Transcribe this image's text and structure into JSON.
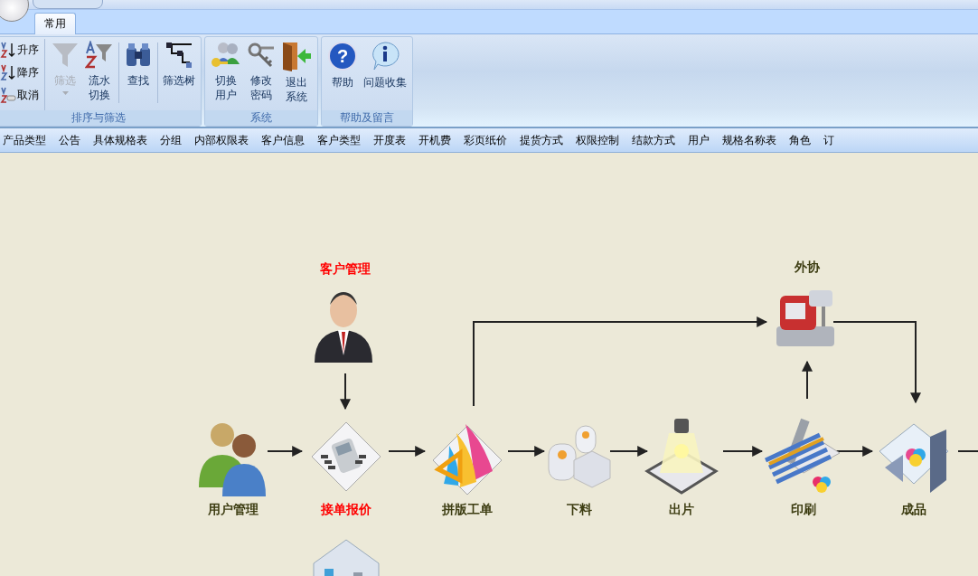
{
  "ribbon": {
    "tabs": [
      {
        "label": "常用",
        "selected": true
      }
    ],
    "groups": [
      {
        "label": "排序与筛选",
        "small_buttons": [
          {
            "label": "升序",
            "kind": "asc"
          },
          {
            "label": "降序",
            "kind": "desc"
          },
          {
            "label": "取消",
            "kind": "clear"
          }
        ],
        "large_buttons": [
          {
            "lines": [
              "筛选"
            ],
            "kind": "filter",
            "disabled": true,
            "dropdown": true
          },
          {
            "lines": [
              "流水",
              "切换"
            ],
            "kind": "azfilter",
            "disabled": false,
            "dropdown": false
          },
          {
            "lines": [
              "查找"
            ],
            "kind": "find",
            "disabled": false,
            "dropdown": false
          },
          {
            "lines": [
              "筛选树"
            ],
            "kind": "tree",
            "disabled": false,
            "dropdown": false
          }
        ]
      },
      {
        "label": "系统",
        "large_buttons": [
          {
            "lines": [
              "切换",
              "用户"
            ],
            "kind": "users",
            "disabled": false,
            "dropdown": false
          },
          {
            "lines": [
              "修改",
              "密码"
            ],
            "kind": "keys",
            "disabled": false,
            "dropdown": false
          },
          {
            "lines": [
              "退出",
              "系统"
            ],
            "kind": "exit",
            "disabled": false,
            "dropdown": false
          }
        ]
      },
      {
        "label": "帮助及留言",
        "large_buttons": [
          {
            "lines": [
              "帮助"
            ],
            "kind": "help",
            "glyph": "?",
            "disabled": false,
            "dropdown": false
          },
          {
            "lines": [
              "问题收集"
            ],
            "kind": "info",
            "disabled": false,
            "dropdown": false
          }
        ]
      }
    ]
  },
  "nav": [
    "产品类型",
    "公告",
    "具体规格表",
    "分组",
    "内部权限表",
    "客户信息",
    "客户类型",
    "开度表",
    "开机费",
    "彩页纸价",
    "提货方式",
    "权限控制",
    "结款方式",
    "用户",
    "规格名称表",
    "角色",
    "订"
  ],
  "flow": {
    "nodes": [
      {
        "label": "客户管理",
        "color": "#ff0000",
        "kind": "person"
      },
      {
        "label": "外协",
        "color": "#3d3d12",
        "kind": "machine"
      },
      {
        "label": "用户管理",
        "color": "#3d3d12",
        "kind": "users"
      },
      {
        "label": "接单报价",
        "color": "#ff0000",
        "kind": "calculator"
      },
      {
        "label": "拼版工单",
        "color": "#3d3d12",
        "kind": "layout"
      },
      {
        "label": "下料",
        "color": "#3d3d12",
        "kind": "rolls"
      },
      {
        "label": "出片",
        "color": "#3d3d12",
        "kind": "lamp"
      },
      {
        "label": "印刷",
        "color": "#3d3d12",
        "kind": "press"
      },
      {
        "label": "成品",
        "color": "#3d3d12",
        "kind": "product"
      }
    ]
  }
}
